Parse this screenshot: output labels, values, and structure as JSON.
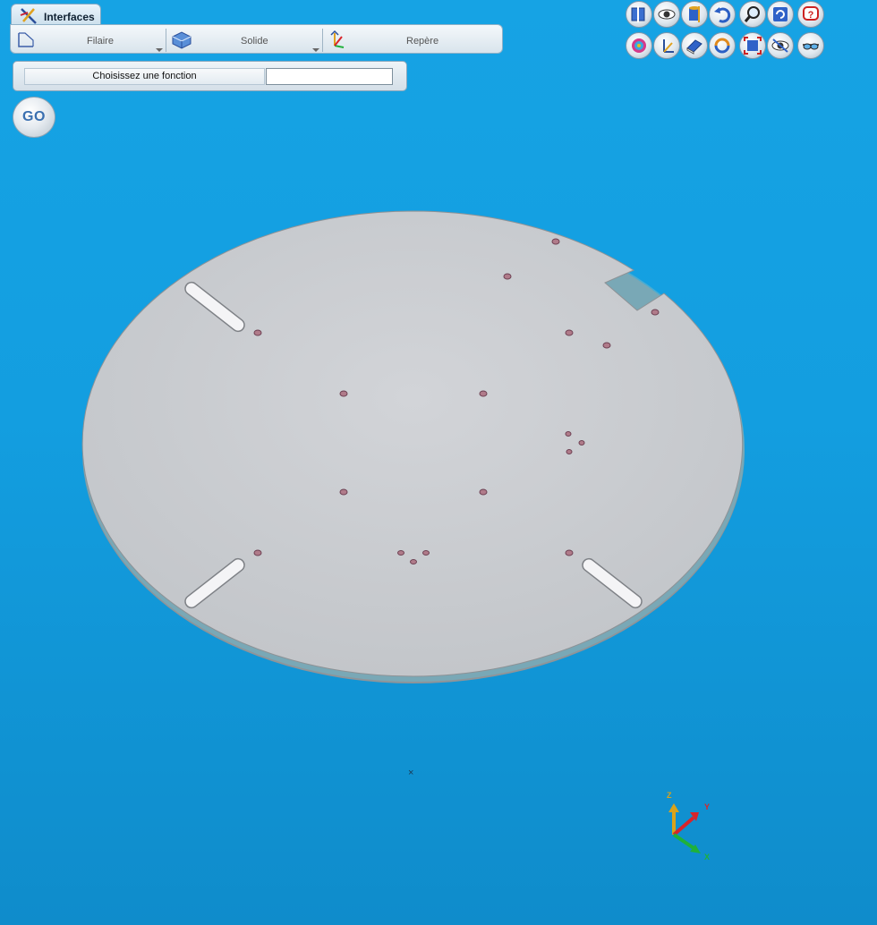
{
  "tab": {
    "label": "Interfaces"
  },
  "toolbar": {
    "wire_label": "Filaire",
    "solid_label": "Solide",
    "frame_label": "Repère"
  },
  "command": {
    "prompt": "Choisissez une fonction",
    "value": ""
  },
  "go_label": "GO",
  "icons_row1": [
    "section-icon",
    "view-icon",
    "cylinder-view-icon",
    "undo-icon",
    "zoom-icon",
    "refresh-icon",
    "help-icon"
  ],
  "icons_row2": [
    "sphere-color-icon",
    "axis-frame-icon",
    "eraser-icon",
    "rotate-icon",
    "fit-view-icon",
    "eye-hide-icon",
    "glasses-icon"
  ],
  "triad": {
    "z": "Z",
    "y": "Y",
    "x": "X"
  },
  "center_marker": "×",
  "colors": {
    "background": "#139ee0",
    "part": "#c9ccd0",
    "axis_x": "#1fb13a",
    "axis_y": "#d9242a",
    "axis_z": "#d9a31b"
  }
}
